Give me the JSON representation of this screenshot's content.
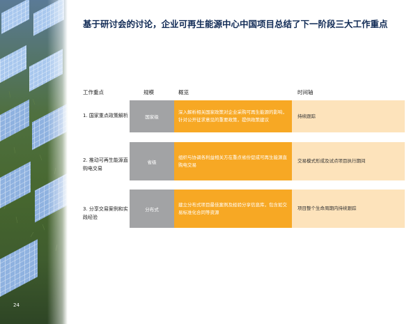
{
  "page": {
    "title": "基于研讨会的讨论，企业可再生能源中心中国项目总结了下一阶段三大工作重点",
    "page_number": "24"
  },
  "table": {
    "headers": {
      "focus": "工作重点",
      "scale": "规模",
      "overview": "概览",
      "timeline": "时间轴"
    },
    "rows": [
      {
        "focus": "1. 国家重点政策解析",
        "scale": "国家级",
        "overview": "深入解析相关国家政策对企业采购可再生能源的影响，针对公开征求意见的重要政策，提供政策建议",
        "timeline": "持续跟踪"
      },
      {
        "focus": "2. 推动可再生能源直购电交易",
        "scale": "省级",
        "overview": "组织与协调各利益相关方在重点省份促成可再生能源直购电交易",
        "timeline": "交易模式形成及试点项目执行期间"
      },
      {
        "focus": "3. 分享交易案例和实践经验",
        "scale": "分布式",
        "overview": "建立分布式项目最佳案例及经验分享信息库，包含如交易标准化合同等资源",
        "timeline": "项目整个生命周期内持续跟踪"
      }
    ]
  },
  "colors": {
    "title": "#102a55",
    "scale_cell": "#a2a3a5",
    "overview_cell": "#f7a824",
    "timeline_cell": "#fde3bb"
  }
}
